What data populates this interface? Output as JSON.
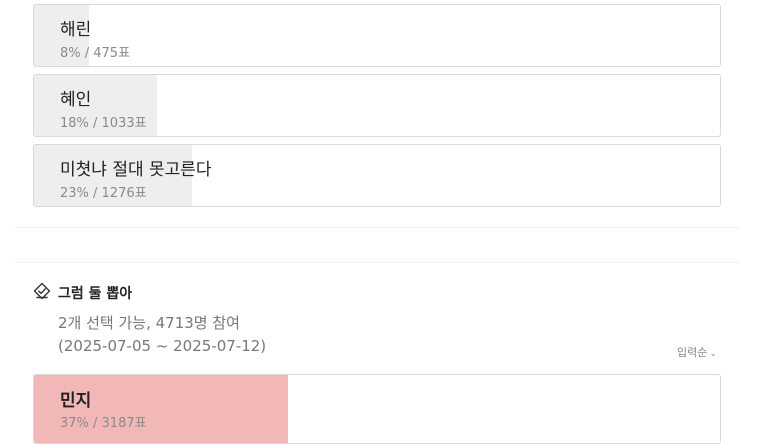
{
  "poll1": {
    "options": [
      {
        "label": "해린",
        "stats": "8% / 475표",
        "percent": 8
      },
      {
        "label": "혜인",
        "stats": "18% / 1033표",
        "percent": 18
      },
      {
        "label": "미쳣냐 절대 못고른다",
        "stats": "23% / 1276표",
        "percent": 23
      }
    ]
  },
  "poll2": {
    "title": "그럼 둘 뽑아",
    "icon": "check-badge-icon",
    "meta": "2개 선택 가능, 4713명 참여",
    "period": "(2025-07-05 ~ 2025-07-12)",
    "sort_label": "입력순",
    "sort_icon": "chevron-down-icon",
    "options": [
      {
        "label": "민지",
        "stats": "37% / 3187표",
        "percent": 37,
        "selected": true
      }
    ]
  },
  "colors": {
    "bar_default": "#eceef0",
    "bar_selected": "#f2b8b8",
    "border": "#d9d9d9"
  }
}
